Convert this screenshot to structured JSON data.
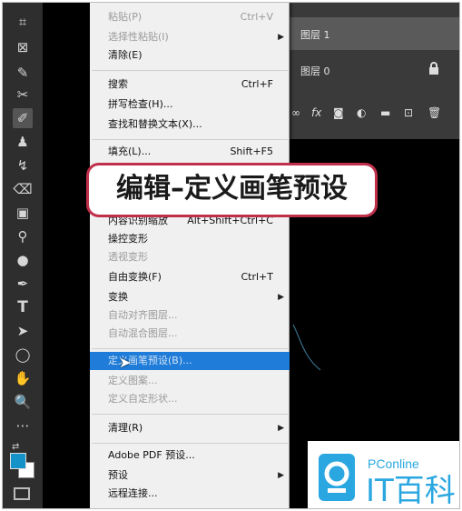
{
  "layers": {
    "items": [
      {
        "name": "图层 1",
        "selected": true
      },
      {
        "name": "图层 0",
        "locked": true
      }
    ],
    "fx_label": "fx"
  },
  "menu": {
    "items": [
      {
        "label": "粘贴(P)",
        "shortcut": "Ctrl+V",
        "disabled": true
      },
      {
        "label": "选择性粘贴(I)",
        "submenu": true,
        "disabled": true
      },
      {
        "label": "清除(E)"
      },
      {
        "label": "搜索",
        "shortcut": "Ctrl+F"
      },
      {
        "label": "拼写检查(H)..."
      },
      {
        "label": "查找和替换文本(X)..."
      },
      {
        "label": "填充(L)...",
        "shortcut": "Shift+F5"
      },
      {
        "label": "内容识别缩放",
        "shortcut": "Alt+Shift+Ctrl+C"
      },
      {
        "label": "操控变形"
      },
      {
        "label": "透视变形",
        "disabled": true
      },
      {
        "label": "自由变换(F)",
        "shortcut": "Ctrl+T"
      },
      {
        "label": "变换",
        "submenu": true
      },
      {
        "label": "自动对齐图层...",
        "disabled": true
      },
      {
        "label": "自动混合图层...",
        "disabled": true
      },
      {
        "label": "定义画笔预设(B)...",
        "highlighted": true
      },
      {
        "label": "定义图案...",
        "disabled": true
      },
      {
        "label": "定义自定形状...",
        "disabled": true
      },
      {
        "label": "清理(R)",
        "submenu": true
      },
      {
        "label": "Adobe PDF 预设..."
      },
      {
        "label": "预设",
        "submenu": true
      },
      {
        "label": "远程连接..."
      }
    ]
  },
  "caption": "编辑–定义画笔预设",
  "watermark": {
    "brand_small": "PConline",
    "brand_large": "IT百科",
    "color": "#2aa7e0"
  },
  "colors": {
    "foreground": "#1593c9",
    "background": "#ffffff",
    "highlight": "#1f7cd8"
  }
}
